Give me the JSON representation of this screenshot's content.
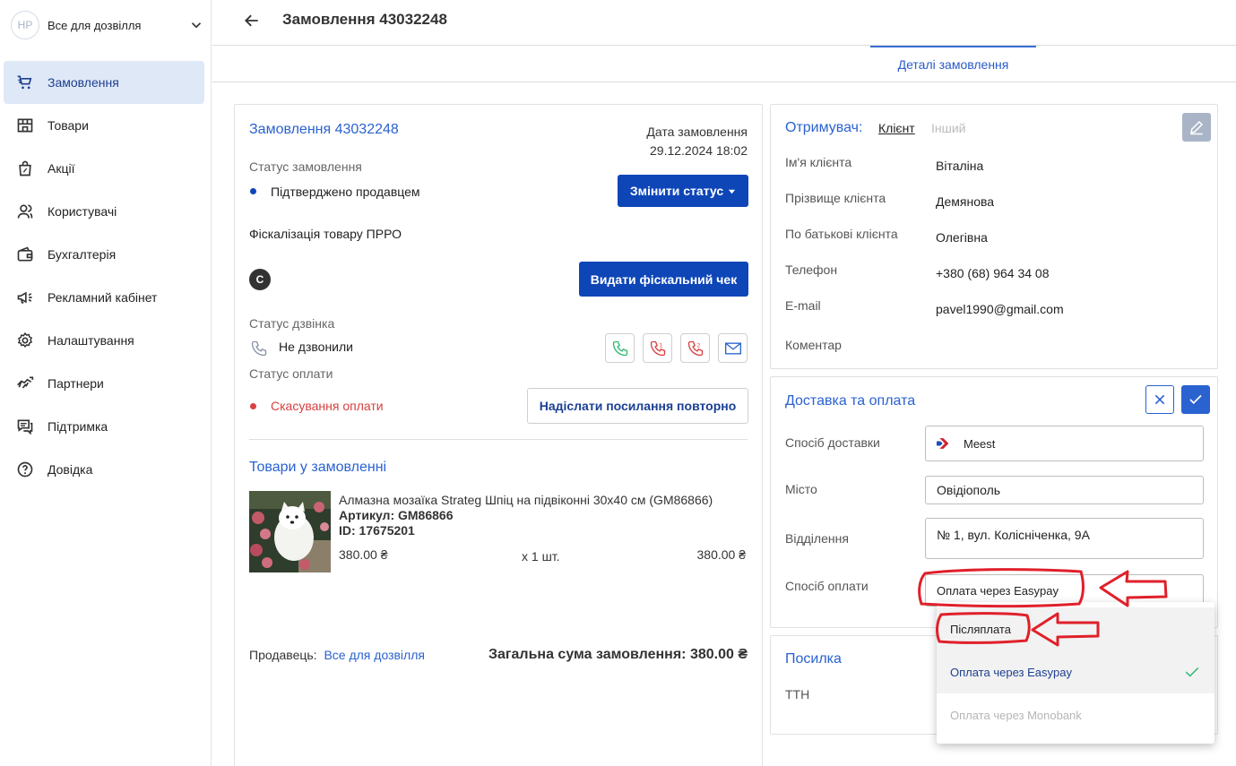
{
  "sidebar": {
    "shop_logo": "HP",
    "shop_name": "Все для дозвілля",
    "items": [
      {
        "label": "Замовлення",
        "icon": "cart-icon",
        "active": true
      },
      {
        "label": "Товари",
        "icon": "store-icon"
      },
      {
        "label": "Акції",
        "icon": "promo-bag-icon"
      },
      {
        "label": "Користувачі",
        "icon": "users-icon"
      },
      {
        "label": "Бухгалтерія",
        "icon": "wallet-icon"
      },
      {
        "label": "Рекламний кабінет",
        "icon": "megaphone-icon"
      },
      {
        "label": "Налаштування",
        "icon": "gear-icon"
      },
      {
        "label": "Партнери",
        "icon": "handshake-icon"
      },
      {
        "label": "Підтримка",
        "icon": "chat-icon"
      },
      {
        "label": "Довідка",
        "icon": "help-icon"
      }
    ]
  },
  "header": {
    "title": "Замовлення 43032248"
  },
  "tabs": {
    "details": "Деталі замовлення"
  },
  "order": {
    "title": "Замовлення 43032248",
    "date_label": "Дата замовлення",
    "date_value": "29.12.2024 18:02",
    "status_label": "Статус замовлення",
    "status_value": "Підтверджено продавцем",
    "change_status_btn": "Змінити статус",
    "fiscal_label": "Фіскалізація товару ПРРО",
    "fiscal_badge": "C",
    "fiscal_btn": "Видати фіскальний чек",
    "call_status_label": "Статус дзвінка",
    "call_status_value": "Не дзвонили",
    "payment_status_label": "Статус оплати",
    "payment_status_value": "Скасування оплати",
    "resend_btn": "Надіслати посилання повторно",
    "products_title": "Товари у замовленні",
    "product": {
      "name": "Алмазна мозаїка Strateg Шпіц на підвіконні 30х40 см (GM86866)",
      "sku": "Артикул: GM86866",
      "id": "ID: 17675201",
      "price": "380.00 ₴",
      "qty": "x 1 шт.",
      "total": "380.00 ₴"
    },
    "seller_label": "Продавець:",
    "seller_name": "Все для дозвілля",
    "total": "Загальна сума замовлення: 380.00 ₴"
  },
  "recipient": {
    "title": "Отримувач:",
    "tab_client": "Клієнт",
    "tab_other": "Інший",
    "fields": [
      {
        "label": "Ім'я клієнта",
        "value": "Віталіна"
      },
      {
        "label": "Прізвище клієнта",
        "value": "Демянова"
      },
      {
        "label": "По батькові клієнта",
        "value": "Олегівна"
      },
      {
        "label": "Телефон",
        "value": "+380 (68) 964 34 08"
      },
      {
        "label": "E-mail",
        "value": "pavel1990@gmail.com"
      },
      {
        "label": "Коментар",
        "value": ""
      }
    ]
  },
  "delivery": {
    "title": "Доставка та оплата",
    "method_label": "Спосіб доставки",
    "method_value": "Meest",
    "city_label": "Місто",
    "city_value": "Овідіополь",
    "branch_label": "Відділення",
    "branch_value": "№ 1, вул. Колісніченка, 9А",
    "payment_label": "Спосіб оплати",
    "payment_value": "Оплата через Easypay"
  },
  "parcel": {
    "title": "Посилка",
    "ttn_label": "ТТН"
  },
  "dropdown": {
    "options": [
      {
        "label": "Післяплата",
        "state": "hover"
      },
      {
        "label": "Оплата через Easypay",
        "state": "selected"
      },
      {
        "label": "Оплата через Monobank",
        "state": "disabled"
      }
    ]
  },
  "colors": {
    "accent": "#0e46b8",
    "link": "#2a62d0",
    "success": "#2eb872",
    "danger": "#d94040",
    "annotation": "#e0202a"
  }
}
